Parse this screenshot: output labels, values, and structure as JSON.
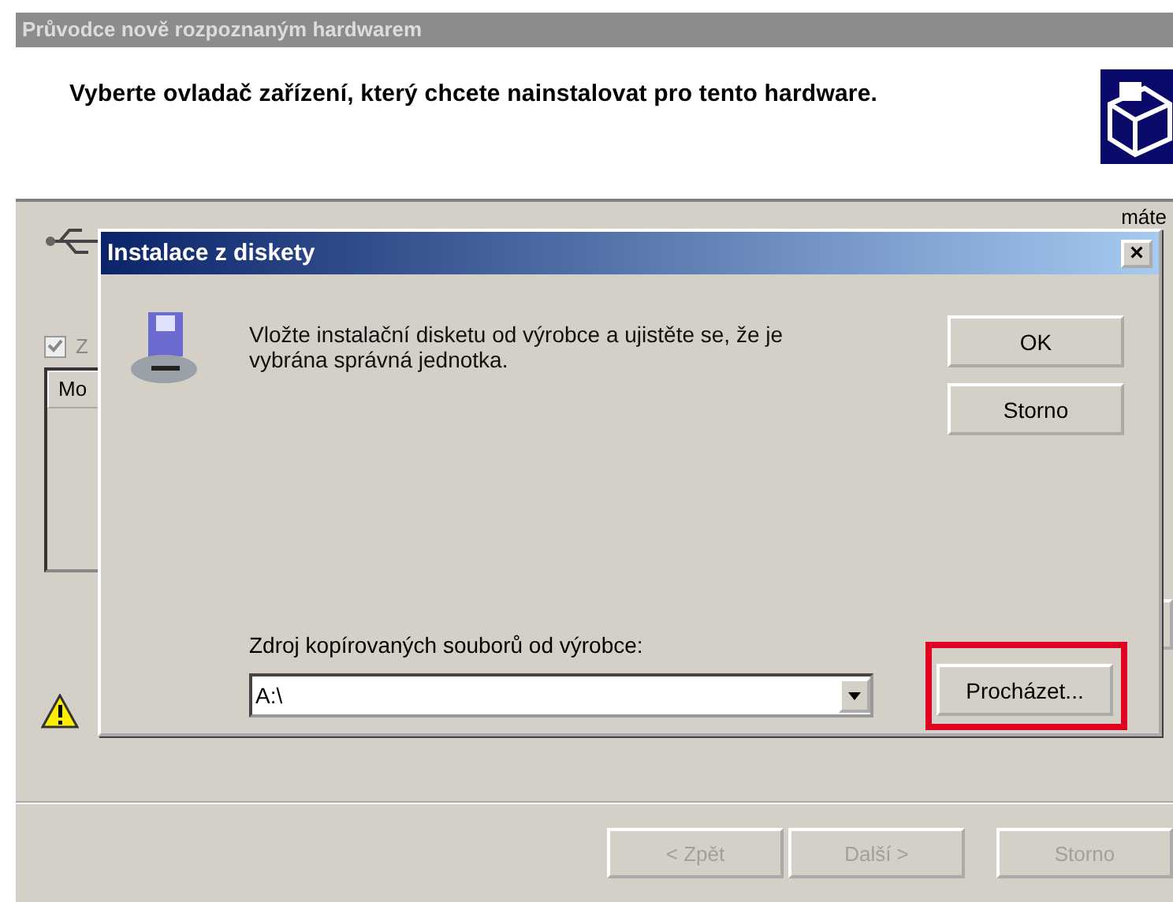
{
  "wizard": {
    "title": "Průvodce nově rozpoznaným hardwarem",
    "heading": "Vyberte ovladač zařízení, který chcete nainstalovat pro tento hardware.",
    "side_text": "máte",
    "checkbox": {
      "label": "Z",
      "checked": true
    },
    "list": {
      "columns": [
        "Mo"
      ]
    },
    "buttons": [
      {
        "label": "< Zpět",
        "disabled": true
      },
      {
        "label": "Další >",
        "disabled": true
      },
      {
        "label": "Storno",
        "disabled": true
      }
    ]
  },
  "dialog": {
    "title": "Instalace z diskety",
    "close": "×",
    "message": "Vložte instalační disketu od výrobce a ujistěte se, že je vybrána správná jednotka.",
    "buttons": [
      {
        "label": "OK"
      },
      {
        "label": "Storno"
      }
    ],
    "source_label": "Zdroj kopírovaných souborů od výrobce:",
    "source_value": "A:\\",
    "browse": {
      "label": "Procházet...",
      "highlighted": true
    }
  }
}
